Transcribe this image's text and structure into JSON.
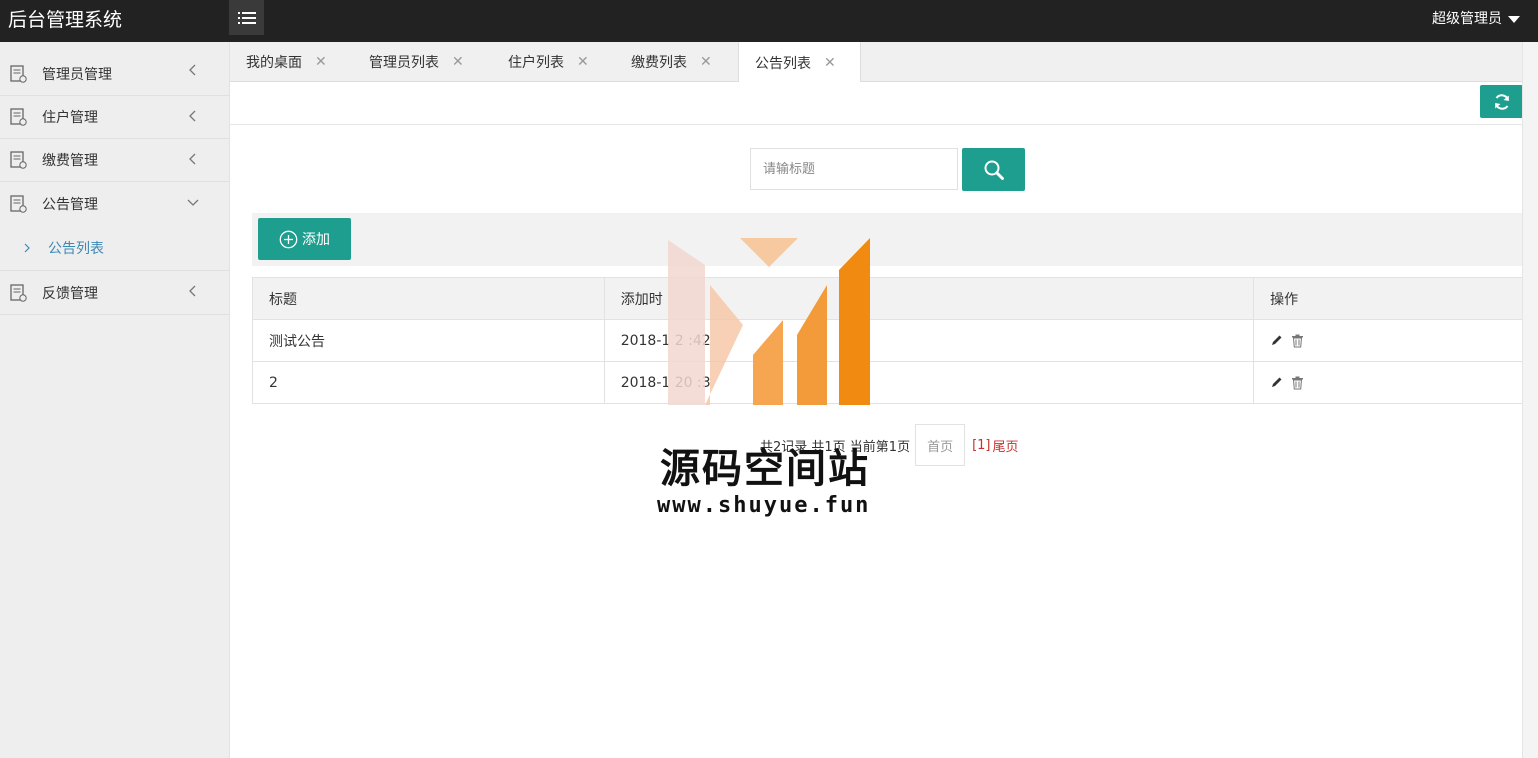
{
  "app": {
    "title": "后台管理系统",
    "user": "超级管理员"
  },
  "sidebar": {
    "items": [
      {
        "label": "管理员管理",
        "expanded": false
      },
      {
        "label": "住户管理",
        "expanded": false
      },
      {
        "label": "缴费管理",
        "expanded": false
      },
      {
        "label": "公告管理",
        "expanded": true
      },
      {
        "label": "反馈管理",
        "expanded": false
      }
    ],
    "sub_items": [
      {
        "label": "公告列表",
        "active": true
      }
    ]
  },
  "tabs": [
    {
      "label": "我的桌面",
      "active": false
    },
    {
      "label": "管理员列表",
      "active": false
    },
    {
      "label": "住户列表",
      "active": false
    },
    {
      "label": "缴费列表",
      "active": false
    },
    {
      "label": "公告列表",
      "active": true
    }
  ],
  "search": {
    "placeholder": "请输标题"
  },
  "toolbar": {
    "add_label": "添加"
  },
  "table": {
    "headers": [
      "标题",
      "添加时",
      "操作"
    ],
    "rows": [
      {
        "title": "测试公告",
        "time": "2018-1  2  :42"
      },
      {
        "title": "2",
        "time": "2018-1   20  :3"
      }
    ]
  },
  "pager": {
    "summary": "共2记录 共1页 当前第1页",
    "first": "首页",
    "pages": "[1]",
    "last": "尾页"
  },
  "watermark": {
    "title": "源码空间站",
    "url": "www.shuyue.fun"
  },
  "colors": {
    "header_bg": "#222222",
    "accent": "#1e9e8f",
    "sidebar_bg": "#eeeeee",
    "link_blue": "#3b8ab5",
    "pager_red": "#c9302c"
  }
}
